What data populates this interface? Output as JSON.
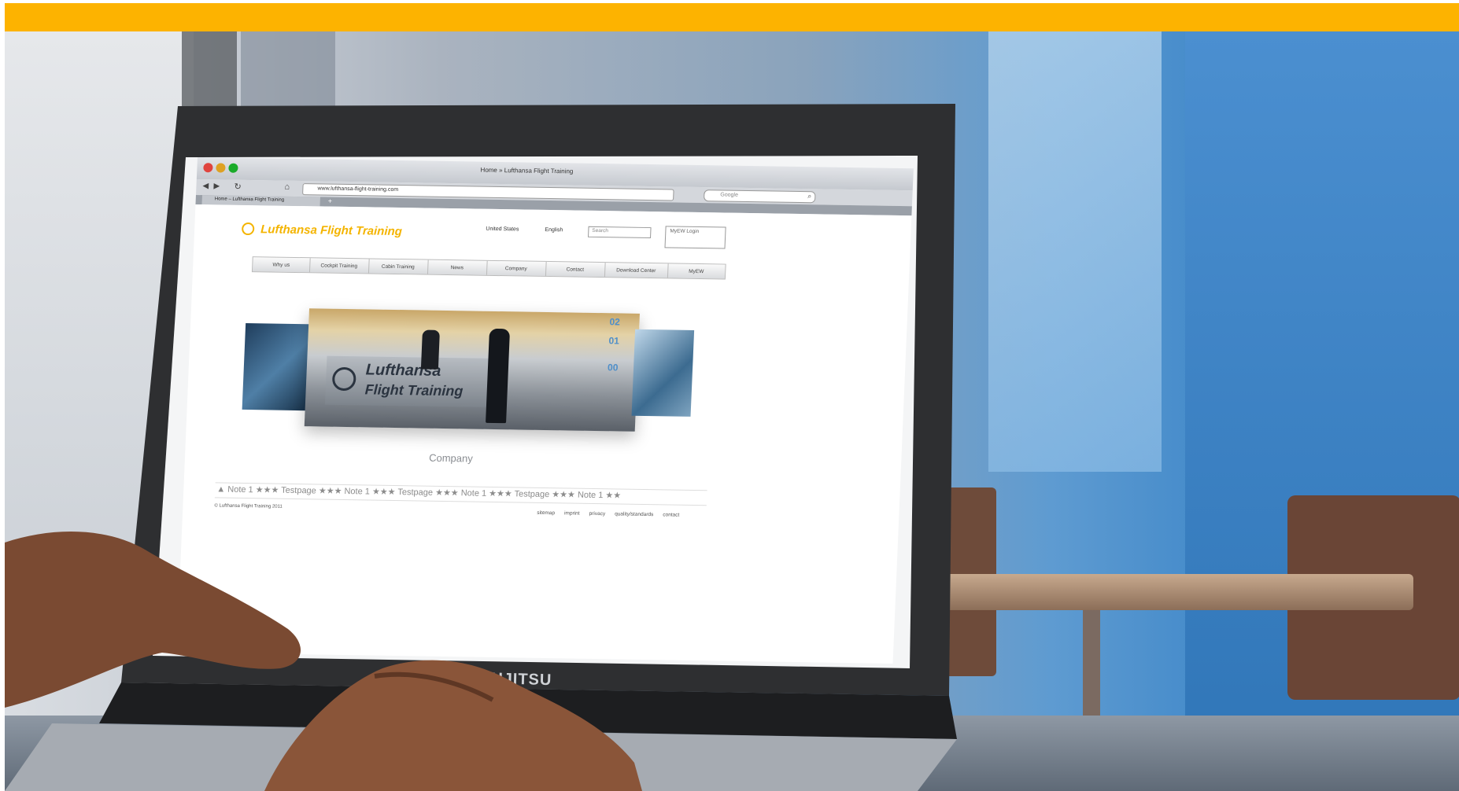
{
  "browser": {
    "window_title": "Home » Lufthansa Flight Training",
    "url": "www.lufthansa-flight-training.com",
    "tab_label": "Home – Lufthansa Flight Training",
    "search_engine_placeholder": "Google"
  },
  "site": {
    "brand": "Lufthansa Flight Training",
    "country": "United States",
    "language": "English",
    "search_placeholder": "Search",
    "login_label": "MyEW Login",
    "nav": [
      "Why us",
      "Cockpit Training",
      "Cabin Training",
      "News",
      "Company",
      "Contact",
      "Download Center",
      "MyEW"
    ],
    "carousel_caption": "Company",
    "carousel_numbers": [
      "02",
      "01",
      "00"
    ],
    "ticker": "▲ Note 1  ★★★  Testpage  ★★★  Note 1  ★★★  Testpage  ★★★  Note 1  ★★★  Testpage  ★★★  Note 1  ★★",
    "copyright": "© Lufthansa Flight Training 2011",
    "footer_links": [
      "sitemap",
      "imprint",
      "privacy",
      "quality/standards",
      "contact"
    ]
  },
  "photo_text": {
    "laptop_brand": "FUJITSU",
    "sign_line1": "Lufthansa",
    "sign_line2": "Flight Training"
  },
  "colors": {
    "top_bar": "#fdb300",
    "brand_yellow": "#f4b400",
    "wall_blue": "#3d86c8"
  }
}
